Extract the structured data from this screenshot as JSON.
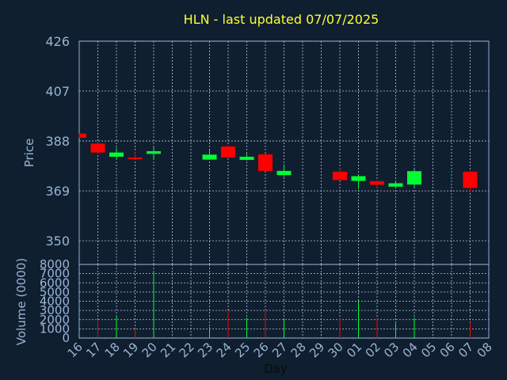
{
  "title": "HLN - last updated 07/07/2025",
  "colors": {
    "background": "#0f1f30",
    "frame": "#8eb0d8",
    "grid": "#b8c8dc",
    "up": "#00ff33",
    "down": "#ff0000",
    "title": "#ffff33",
    "text": "#9ab4d4"
  },
  "chart_data": [
    {
      "type": "candlestick",
      "ylabel": "Price",
      "ylim": [
        341,
        426
      ],
      "yticks": [
        426,
        407,
        388,
        369,
        350
      ],
      "grid": true,
      "x": [
        "16",
        "17",
        "18",
        "19",
        "20",
        "21",
        "22",
        "23",
        "24",
        "25",
        "26",
        "27",
        "28",
        "29",
        "30",
        "01",
        "02",
        "03",
        "04",
        "05",
        "06",
        "07",
        "08"
      ],
      "candles": [
        {
          "x": "16",
          "open": 390.8,
          "close": 389.2,
          "high": 390.8,
          "low": 389.2
        },
        {
          "x": "17",
          "open": 387.0,
          "close": 383.6,
          "high": 387.3,
          "low": 383.2
        },
        {
          "x": "18",
          "open": 382.0,
          "close": 383.6,
          "high": 385.4,
          "low": 381.4
        },
        {
          "x": "19",
          "open": 381.7,
          "close": 381.2,
          "high": 383.7,
          "low": 380.9
        },
        {
          "x": "20",
          "open": 383.1,
          "close": 384.1,
          "high": 386.1,
          "low": 381.0
        },
        {
          "x": "23",
          "open": 380.9,
          "close": 382.8,
          "high": 384.6,
          "low": 380.9
        },
        {
          "x": "24",
          "open": 385.9,
          "close": 381.7,
          "high": 386.3,
          "low": 381.7
        },
        {
          "x": "25",
          "open": 380.8,
          "close": 382.0,
          "high": 383.1,
          "low": 380.6
        },
        {
          "x": "26",
          "open": 382.9,
          "close": 376.6,
          "high": 383.2,
          "low": 376.6
        },
        {
          "x": "27",
          "open": 375.0,
          "close": 376.6,
          "high": 379.1,
          "low": 374.3
        },
        {
          "x": "30",
          "open": 376.3,
          "close": 373.1,
          "high": 377.5,
          "low": 373.1
        },
        {
          "x": "01",
          "open": 372.8,
          "close": 374.6,
          "high": 375.0,
          "low": 369.7
        },
        {
          "x": "02",
          "open": 372.7,
          "close": 371.3,
          "high": 373.0,
          "low": 370.1
        },
        {
          "x": "03",
          "open": 370.6,
          "close": 371.9,
          "high": 372.4,
          "low": 370.6
        },
        {
          "x": "04",
          "open": 371.4,
          "close": 376.5,
          "high": 377.2,
          "low": 370.6
        },
        {
          "x": "07",
          "open": 376.3,
          "close": 370.1,
          "high": 376.5,
          "low": 368.4
        }
      ]
    },
    {
      "type": "bar",
      "ylabel": "Volume (0000)",
      "xlabel": "Day",
      "ylim": [
        0,
        8000
      ],
      "yticks": [
        8000,
        7000,
        6000,
        5000,
        4000,
        3000,
        2000,
        1000,
        0
      ],
      "grid": true,
      "bars": [
        {
          "x": "17",
          "value": 1900,
          "direction": "down"
        },
        {
          "x": "18",
          "value": 2400,
          "direction": "up"
        },
        {
          "x": "19",
          "value": 1000,
          "direction": "down"
        },
        {
          "x": "20",
          "value": 7200,
          "direction": "up"
        },
        {
          "x": "23",
          "value": 1200,
          "direction": "up"
        },
        {
          "x": "24",
          "value": 2900,
          "direction": "down"
        },
        {
          "x": "25",
          "value": 2200,
          "direction": "up"
        },
        {
          "x": "26",
          "value": 3100,
          "direction": "down"
        },
        {
          "x": "27",
          "value": 2100,
          "direction": "up"
        },
        {
          "x": "30",
          "value": 2200,
          "direction": "down"
        },
        {
          "x": "01",
          "value": 4000,
          "direction": "up"
        },
        {
          "x": "02",
          "value": 2200,
          "direction": "down"
        },
        {
          "x": "03",
          "value": 1600,
          "direction": "up"
        },
        {
          "x": "04",
          "value": 2200,
          "direction": "up"
        },
        {
          "x": "07",
          "value": 1700,
          "direction": "down"
        }
      ]
    }
  ]
}
